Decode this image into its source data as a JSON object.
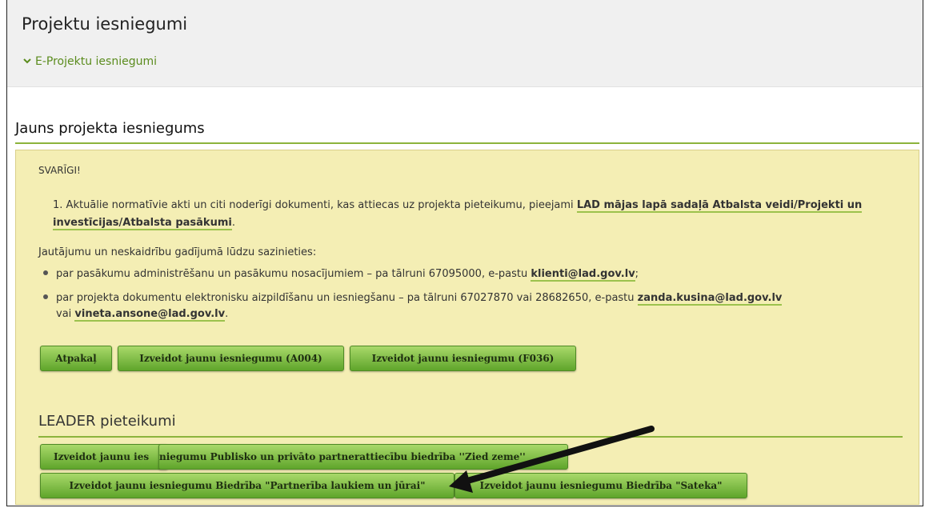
{
  "header": {
    "title": "Projektu iesniegumi",
    "link_label": "E-Projektu iesniegumi"
  },
  "section": {
    "title": "Jauns projekta iesniegums"
  },
  "notice": {
    "important_label": "SVARĪGI!",
    "item1_number": "1.",
    "item1_text": "Aktuālie normatīvie akti un citi noderīgi dokumenti, kas attiecas uz projekta pieteikumu, pieejami",
    "item1_link": "LAD mājas lapā sadaļā Atbalsta veidi/Projekti un investīcijas/Atbalsta pasākumi",
    "item1_end": ".",
    "contact_intro": "Jautājumu un neskaidrību gadījumā lūdzu sazinieties:",
    "bullet1_text": "par pasākumu administrēšanu un pasākumu nosacījumiem – pa tālruni 67095000, e-pastu",
    "bullet1_email": "klienti@lad.gov.lv",
    "bullet1_end": ";",
    "bullet2_text": "par projekta dokumentu elektronisku aizpildīšanu un iesniegšanu – pa tālruni 67027870 vai 28682650, e-pastu",
    "bullet2_email1": "zanda.kusina@lad.gov.lv",
    "bullet2_or": "vai",
    "bullet2_email2": "vineta.ansone@lad.gov.lv",
    "bullet2_end": "."
  },
  "buttons": {
    "back": "Atpakaļ",
    "create_a004": "Izveidot jaunu iesniegumu (A004)",
    "create_f036": "Izveidot jaunu iesniegumu (F036)"
  },
  "leader": {
    "title": "LEADER pieteikumi",
    "btn1_part1": "Izveidot jaunu ies",
    "btn1_part2": "niegumu Publisko un privāto partnerattiecību biedrība ''Zied zeme''",
    "btn2": "Izveidot jaunu iesniegumu Biedrība \"Partnerība laukiem un jūrai\"",
    "btn3": "Izveidot jaunu iesniegumu Biedrība \"Sateka\""
  },
  "colors": {
    "accent_green": "#8cb43c",
    "notice_bg": "#f4eeb4",
    "button_green": "#5fa52b"
  }
}
